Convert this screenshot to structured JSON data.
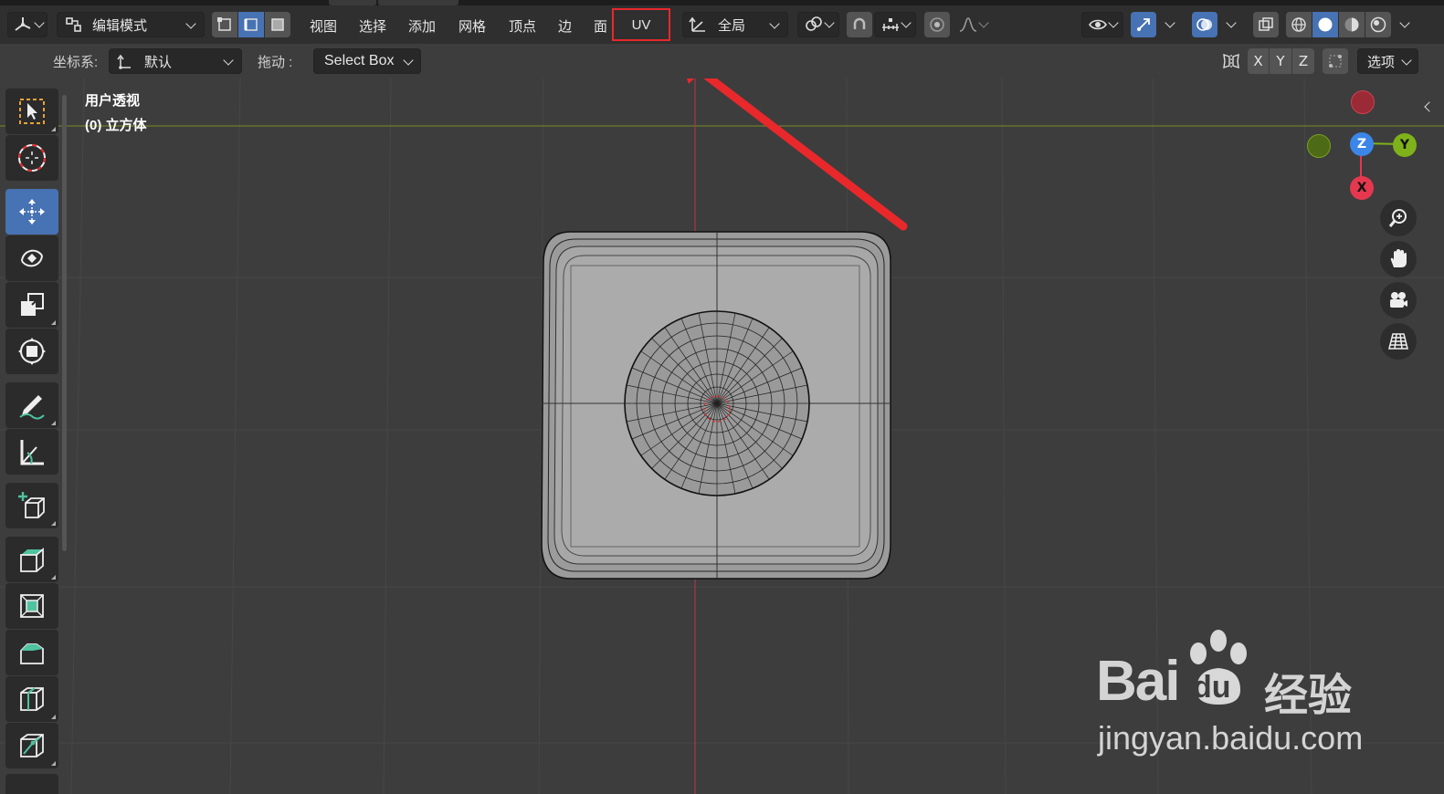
{
  "header": {
    "mode_label": "编辑模式",
    "menus": [
      "视图",
      "选择",
      "添加",
      "网格",
      "顶点",
      "边",
      "面",
      "UV"
    ],
    "transform_orientation": "全局"
  },
  "subheader": {
    "coord_label": "坐标系:",
    "coord_value": "默认",
    "drag_label": "拖动 :",
    "drag_value": "Select Box",
    "axis_x": "X",
    "axis_y": "Y",
    "axis_z": "Z",
    "options_label": "选项"
  },
  "viewport": {
    "view_name": "用户透视",
    "object_name": "(0) 立方体"
  },
  "gizmo": {
    "z": "Z",
    "y": "Y",
    "x": "X"
  },
  "watermark": {
    "brand": "Bai",
    "brand2": "du",
    "cn": "经验",
    "url": "jingyan.baidu.com"
  },
  "colors": {
    "accent_blue": "#4772b3",
    "highlight_red": "#e8282b",
    "axis_x": "#e5384f",
    "axis_y": "#7fb21a",
    "axis_z": "#3b86e8"
  },
  "tools": [
    "select-box-tool",
    "cursor-tool",
    "move-tool",
    "rotate-tool",
    "scale-tool",
    "transform-tool",
    "annotate-tool",
    "measure-tool",
    "add-cube-tool",
    "extrude-tool",
    "inset-tool",
    "bevel-tool",
    "loop-cut-tool",
    "knife-tool"
  ]
}
